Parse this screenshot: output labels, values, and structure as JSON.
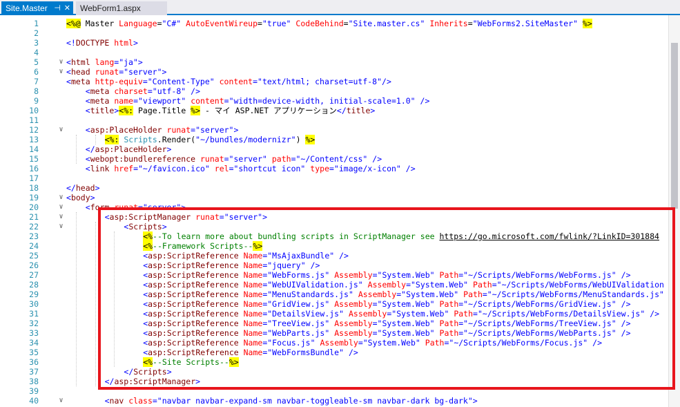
{
  "tabs": [
    {
      "label": "Site.Master",
      "active": true
    },
    {
      "label": "WebForm1.aspx",
      "active": false
    }
  ],
  "tab_icons": {
    "pin": "⊣",
    "close": "✕"
  },
  "lines": [
    {
      "n": "1",
      "i": 0,
      "s": [
        [
          "hl",
          "<%@"
        ],
        [
          "p",
          " Master "
        ],
        [
          "a",
          "Language"
        ],
        [
          "p",
          "="
        ],
        [
          "v",
          "\"C#\""
        ],
        [
          "p",
          " "
        ],
        [
          "a",
          "AutoEventWireup"
        ],
        [
          "p",
          "="
        ],
        [
          "v",
          "\"true\""
        ],
        [
          "p",
          " "
        ],
        [
          "a",
          "CodeBehind"
        ],
        [
          "p",
          "="
        ],
        [
          "v",
          "\"Site.master.cs\""
        ],
        [
          "p",
          " "
        ],
        [
          "a",
          "Inherits"
        ],
        [
          "p",
          "="
        ],
        [
          "v",
          "\"WebForms2.SiteMaster\""
        ],
        [
          "p",
          " "
        ],
        [
          "hl",
          "%>"
        ]
      ]
    },
    {
      "n": "2",
      "i": 0,
      "s": []
    },
    {
      "n": "3",
      "i": 0,
      "s": [
        [
          "v",
          "<!"
        ],
        [
          "t",
          "DOCTYPE"
        ],
        [
          "p",
          " "
        ],
        [
          "a",
          "html"
        ],
        [
          "v",
          ">"
        ]
      ]
    },
    {
      "n": "4",
      "i": 0,
      "s": []
    },
    {
      "n": "5",
      "i": 0,
      "s": [
        [
          "v",
          "<"
        ],
        [
          "t",
          "html"
        ],
        [
          "p",
          " "
        ],
        [
          "a",
          "lang"
        ],
        [
          "v",
          "=\"ja\">"
        ]
      ]
    },
    {
      "n": "6",
      "i": 0,
      "s": [
        [
          "v",
          "<"
        ],
        [
          "t",
          "head"
        ],
        [
          "p",
          " "
        ],
        [
          "a",
          "runat"
        ],
        [
          "v",
          "=\"server\">"
        ]
      ]
    },
    {
      "n": "7",
      "i": 0,
      "s": [
        [
          "v",
          "<"
        ],
        [
          "t",
          "meta"
        ],
        [
          "p",
          " "
        ],
        [
          "a",
          "http-equiv"
        ],
        [
          "v",
          "=\"Content-Type\""
        ],
        [
          "p",
          " "
        ],
        [
          "a",
          "content"
        ],
        [
          "v",
          "=\"text/html; charset=utf-8\"/>"
        ]
      ]
    },
    {
      "n": "8",
      "i": 1,
      "s": [
        [
          "v",
          "<"
        ],
        [
          "t",
          "meta"
        ],
        [
          "p",
          " "
        ],
        [
          "a",
          "charset"
        ],
        [
          "v",
          "=\"utf-8\""
        ],
        [
          "p",
          " "
        ],
        [
          "v",
          "/>"
        ]
      ]
    },
    {
      "n": "9",
      "i": 1,
      "s": [
        [
          "v",
          "<"
        ],
        [
          "t",
          "meta"
        ],
        [
          "p",
          " "
        ],
        [
          "a",
          "name"
        ],
        [
          "v",
          "=\"viewport\""
        ],
        [
          "p",
          " "
        ],
        [
          "a",
          "content"
        ],
        [
          "v",
          "=\"width=device-width, initial-scale=1.0\""
        ],
        [
          "p",
          " "
        ],
        [
          "v",
          "/>"
        ]
      ]
    },
    {
      "n": "10",
      "i": 1,
      "s": [
        [
          "v",
          "<"
        ],
        [
          "t",
          "title"
        ],
        [
          "v",
          ">"
        ],
        [
          "hl",
          "<%:"
        ],
        [
          "p",
          " Page.Title "
        ],
        [
          "hl",
          "%>"
        ],
        [
          "p",
          " - マイ ASP.NET アプリケーション"
        ],
        [
          "v",
          "</"
        ],
        [
          "t",
          "title"
        ],
        [
          "v",
          ">"
        ]
      ]
    },
    {
      "n": "11",
      "i": 0,
      "s": []
    },
    {
      "n": "12",
      "i": 1,
      "s": [
        [
          "v",
          "<"
        ],
        [
          "t",
          "asp:PlaceHolder"
        ],
        [
          "p",
          " "
        ],
        [
          "a",
          "runat"
        ],
        [
          "v",
          "=\"server\">"
        ]
      ]
    },
    {
      "n": "13",
      "i": 2,
      "s": [
        [
          "hl",
          "<%:"
        ],
        [
          "p",
          " "
        ],
        [
          "cls",
          "Scripts"
        ],
        [
          "p",
          ".Render("
        ],
        [
          "v",
          "\"~/bundles/modernizr\""
        ],
        [
          "p",
          ") "
        ],
        [
          "hl",
          "%>"
        ]
      ]
    },
    {
      "n": "14",
      "i": 1,
      "s": [
        [
          "v",
          "</"
        ],
        [
          "t",
          "asp:PlaceHolder"
        ],
        [
          "v",
          ">"
        ]
      ]
    },
    {
      "n": "15",
      "i": 1,
      "s": [
        [
          "v",
          "<"
        ],
        [
          "t",
          "webopt:bundlereference"
        ],
        [
          "p",
          " "
        ],
        [
          "a",
          "runat"
        ],
        [
          "v",
          "=\"server\""
        ],
        [
          "p",
          " "
        ],
        [
          "a",
          "path"
        ],
        [
          "v",
          "=\"~/Content/css\""
        ],
        [
          "p",
          " "
        ],
        [
          "v",
          "/>"
        ]
      ]
    },
    {
      "n": "16",
      "i": 1,
      "s": [
        [
          "v",
          "<"
        ],
        [
          "t",
          "link"
        ],
        [
          "p",
          " "
        ],
        [
          "a",
          "href"
        ],
        [
          "v",
          "=\"~/favicon.ico\""
        ],
        [
          "p",
          " "
        ],
        [
          "a",
          "rel"
        ],
        [
          "v",
          "=\"shortcut icon\""
        ],
        [
          "p",
          " "
        ],
        [
          "a",
          "type"
        ],
        [
          "v",
          "=\"image/x-icon\""
        ],
        [
          "p",
          " "
        ],
        [
          "v",
          "/>"
        ]
      ]
    },
    {
      "n": "17",
      "i": 0,
      "s": []
    },
    {
      "n": "18",
      "i": 0,
      "s": [
        [
          "v",
          "</"
        ],
        [
          "t",
          "head"
        ],
        [
          "v",
          ">"
        ]
      ]
    },
    {
      "n": "19",
      "i": 0,
      "s": [
        [
          "v",
          "<"
        ],
        [
          "t",
          "body"
        ],
        [
          "v",
          ">"
        ]
      ]
    },
    {
      "n": "20",
      "i": 1,
      "s": [
        [
          "v",
          "<"
        ],
        [
          "t",
          "form"
        ],
        [
          "p",
          " "
        ],
        [
          "a",
          "runat"
        ],
        [
          "v",
          "=\"server\">"
        ]
      ]
    },
    {
      "n": "21",
      "i": 2,
      "s": [
        [
          "v",
          "<"
        ],
        [
          "t",
          "asp:ScriptManager"
        ],
        [
          "p",
          " "
        ],
        [
          "a",
          "runat"
        ],
        [
          "v",
          "=\"server\">"
        ]
      ]
    },
    {
      "n": "22",
      "i": 3,
      "s": [
        [
          "v",
          "<"
        ],
        [
          "t",
          "Scripts"
        ],
        [
          "v",
          ">"
        ]
      ]
    },
    {
      "n": "23",
      "i": 4,
      "s": [
        [
          "hl",
          "<%"
        ],
        [
          "c",
          "--To learn more about bundling scripts in ScriptManager see "
        ],
        [
          "link",
          "https://go.microsoft.com/fwlink/?LinkID=301884"
        ]
      ]
    },
    {
      "n": "24",
      "i": 4,
      "s": [
        [
          "hl",
          "<%"
        ],
        [
          "c",
          "--Framework Scripts--"
        ],
        [
          "hl",
          "%>"
        ]
      ]
    },
    {
      "n": "25",
      "i": 4,
      "s": [
        [
          "v",
          "<"
        ],
        [
          "t",
          "asp:ScriptReference"
        ],
        [
          "p",
          " "
        ],
        [
          "a",
          "Name"
        ],
        [
          "v",
          "=\"MsAjaxBundle\""
        ],
        [
          "p",
          " "
        ],
        [
          "v",
          "/>"
        ]
      ]
    },
    {
      "n": "26",
      "i": 4,
      "s": [
        [
          "v",
          "<"
        ],
        [
          "t",
          "asp:ScriptReference"
        ],
        [
          "p",
          " "
        ],
        [
          "a",
          "Name"
        ],
        [
          "v",
          "=\"jquery\""
        ],
        [
          "p",
          " "
        ],
        [
          "v",
          "/>"
        ]
      ]
    },
    {
      "n": "27",
      "i": 4,
      "s": [
        [
          "v",
          "<"
        ],
        [
          "t",
          "asp:ScriptReference"
        ],
        [
          "p",
          " "
        ],
        [
          "a",
          "Name"
        ],
        [
          "v",
          "=\"WebForms.js\""
        ],
        [
          "p",
          " "
        ],
        [
          "a",
          "Assembly"
        ],
        [
          "v",
          "=\"System.Web\""
        ],
        [
          "p",
          " "
        ],
        [
          "a",
          "Path"
        ],
        [
          "v",
          "=\"~/Scripts/WebForms/WebForms.js\""
        ],
        [
          "p",
          " "
        ],
        [
          "v",
          "/>"
        ]
      ]
    },
    {
      "n": "28",
      "i": 4,
      "s": [
        [
          "v",
          "<"
        ],
        [
          "t",
          "asp:ScriptReference"
        ],
        [
          "p",
          " "
        ],
        [
          "a",
          "Name"
        ],
        [
          "v",
          "=\"WebUIValidation.js\""
        ],
        [
          "p",
          " "
        ],
        [
          "a",
          "Assembly"
        ],
        [
          "v",
          "=\"System.Web\""
        ],
        [
          "p",
          " "
        ],
        [
          "a",
          "Path"
        ],
        [
          "v",
          "=\"~/Scripts/WebForms/WebUIValidation"
        ]
      ]
    },
    {
      "n": "29",
      "i": 4,
      "s": [
        [
          "v",
          "<"
        ],
        [
          "t",
          "asp:ScriptReference"
        ],
        [
          "p",
          " "
        ],
        [
          "a",
          "Name"
        ],
        [
          "v",
          "=\"MenuStandards.js\""
        ],
        [
          "p",
          " "
        ],
        [
          "a",
          "Assembly"
        ],
        [
          "v",
          "=\"System.Web\""
        ],
        [
          "p",
          " "
        ],
        [
          "a",
          "Path"
        ],
        [
          "v",
          "=\"~/Scripts/WebForms/MenuStandards.js\""
        ]
      ]
    },
    {
      "n": "30",
      "i": 4,
      "s": [
        [
          "v",
          "<"
        ],
        [
          "t",
          "asp:ScriptReference"
        ],
        [
          "p",
          " "
        ],
        [
          "a",
          "Name"
        ],
        [
          "v",
          "=\"GridView.js\""
        ],
        [
          "p",
          " "
        ],
        [
          "a",
          "Assembly"
        ],
        [
          "v",
          "=\"System.Web\""
        ],
        [
          "p",
          " "
        ],
        [
          "a",
          "Path"
        ],
        [
          "v",
          "=\"~/Scripts/WebForms/GridView.js\""
        ],
        [
          "p",
          " "
        ],
        [
          "v",
          "/>"
        ]
      ]
    },
    {
      "n": "31",
      "i": 4,
      "s": [
        [
          "v",
          "<"
        ],
        [
          "t",
          "asp:ScriptReference"
        ],
        [
          "p",
          " "
        ],
        [
          "a",
          "Name"
        ],
        [
          "v",
          "=\"DetailsView.js\""
        ],
        [
          "p",
          " "
        ],
        [
          "a",
          "Assembly"
        ],
        [
          "v",
          "=\"System.Web\""
        ],
        [
          "p",
          " "
        ],
        [
          "a",
          "Path"
        ],
        [
          "v",
          "=\"~/Scripts/WebForms/DetailsView.js\""
        ],
        [
          "p",
          " "
        ],
        [
          "v",
          "/>"
        ]
      ]
    },
    {
      "n": "32",
      "i": 4,
      "s": [
        [
          "v",
          "<"
        ],
        [
          "t",
          "asp:ScriptReference"
        ],
        [
          "p",
          " "
        ],
        [
          "a",
          "Name"
        ],
        [
          "v",
          "=\"TreeView.js\""
        ],
        [
          "p",
          " "
        ],
        [
          "a",
          "Assembly"
        ],
        [
          "v",
          "=\"System.Web\""
        ],
        [
          "p",
          " "
        ],
        [
          "a",
          "Path"
        ],
        [
          "v",
          "=\"~/Scripts/WebForms/TreeView.js\""
        ],
        [
          "p",
          " "
        ],
        [
          "v",
          "/>"
        ]
      ]
    },
    {
      "n": "33",
      "i": 4,
      "s": [
        [
          "v",
          "<"
        ],
        [
          "t",
          "asp:ScriptReference"
        ],
        [
          "p",
          " "
        ],
        [
          "a",
          "Name"
        ],
        [
          "v",
          "=\"WebParts.js\""
        ],
        [
          "p",
          " "
        ],
        [
          "a",
          "Assembly"
        ],
        [
          "v",
          "=\"System.Web\""
        ],
        [
          "p",
          " "
        ],
        [
          "a",
          "Path"
        ],
        [
          "v",
          "=\"~/Scripts/WebForms/WebParts.js\""
        ],
        [
          "p",
          " "
        ],
        [
          "v",
          "/>"
        ]
      ]
    },
    {
      "n": "34",
      "i": 4,
      "s": [
        [
          "v",
          "<"
        ],
        [
          "t",
          "asp:ScriptReference"
        ],
        [
          "p",
          " "
        ],
        [
          "a",
          "Name"
        ],
        [
          "v",
          "=\"Focus.js\""
        ],
        [
          "p",
          " "
        ],
        [
          "a",
          "Assembly"
        ],
        [
          "v",
          "=\"System.Web\""
        ],
        [
          "p",
          " "
        ],
        [
          "a",
          "Path"
        ],
        [
          "v",
          "=\"~/Scripts/WebForms/Focus.js\""
        ],
        [
          "p",
          " "
        ],
        [
          "v",
          "/>"
        ]
      ]
    },
    {
      "n": "35",
      "i": 4,
      "s": [
        [
          "v",
          "<"
        ],
        [
          "t",
          "asp:ScriptReference"
        ],
        [
          "p",
          " "
        ],
        [
          "a",
          "Name"
        ],
        [
          "v",
          "=\"WebFormsBundle\""
        ],
        [
          "p",
          " "
        ],
        [
          "v",
          "/>"
        ]
      ]
    },
    {
      "n": "36",
      "i": 4,
      "s": [
        [
          "hl",
          "<%"
        ],
        [
          "c",
          "--Site Scripts--"
        ],
        [
          "hl",
          "%>"
        ]
      ]
    },
    {
      "n": "37",
      "i": 3,
      "s": [
        [
          "v",
          "</"
        ],
        [
          "t",
          "Scripts"
        ],
        [
          "v",
          ">"
        ]
      ]
    },
    {
      "n": "38",
      "i": 2,
      "s": [
        [
          "v",
          "</"
        ],
        [
          "t",
          "asp:ScriptManager"
        ],
        [
          "v",
          ">"
        ]
      ]
    },
    {
      "n": "39",
      "i": 0,
      "s": []
    },
    {
      "n": "40",
      "i": 2,
      "s": [
        [
          "v",
          "<"
        ],
        [
          "t",
          "nav"
        ],
        [
          "p",
          " "
        ],
        [
          "a",
          "class"
        ],
        [
          "v",
          "=\"navbar navbar-expand-sm navbar-toggleable-sm navbar-dark bg-dark\">"
        ]
      ]
    }
  ],
  "fold_markers": {
    "5": "∨",
    "6": "∨",
    "12": "∨",
    "19": "∨",
    "20": "∨",
    "21": "∨",
    "22": "∨",
    "40": "∨"
  }
}
